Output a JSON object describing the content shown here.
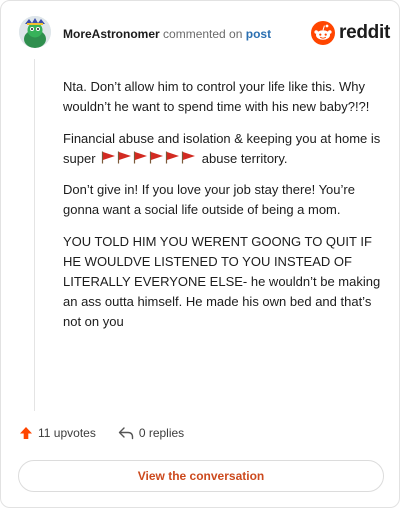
{
  "header": {
    "username": "MoreAstronomer",
    "action": "commented on",
    "post_link": "post",
    "brand": "reddit"
  },
  "comment": {
    "paragraphs": [
      "Nta. Don’t allow him to control your life like this. Why wouldn’t he want to spend time with his new baby?!?!",
      {
        "before": "Financial abuse and isolation & keeping you at home is super",
        "after": "abuse territory.",
        "flag_count": 6
      },
      "Don’t give in! If you love your job stay there! You’re gonna want a social life outside of being a mom.",
      "YOU TOLD HIM YOU WERENT GOONG TO QUIT IF HE WOULDVE LISTENED TO YOU INSTEAD OF LITERALLY EVERYONE ELSE- he wouldn’t be making an ass outta himself. He made his own bed and that’s not on you"
    ]
  },
  "footer": {
    "upvotes": "11 upvotes",
    "replies": "0 replies",
    "view_button": "View the conversation"
  },
  "colors": {
    "accent": "#ff4500",
    "link": "#2a6fb1",
    "view_button_text": "#cc4a1e",
    "flag_red": "#d22b22"
  },
  "icons": {
    "avatar": "snoo-avatar",
    "brand": "reddit-logo-icon",
    "upvote": "upvote-arrow-icon",
    "reply": "reply-arrow-icon",
    "flag": "red-flag-icon"
  }
}
